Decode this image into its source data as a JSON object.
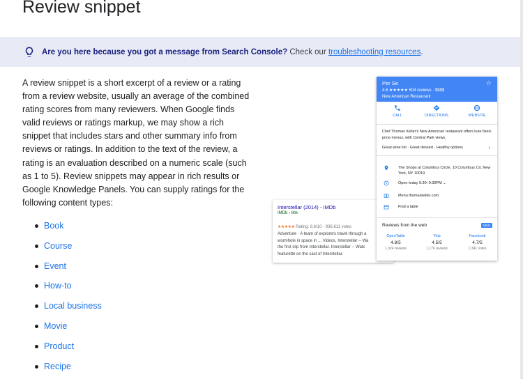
{
  "page": {
    "title": "Review snippet"
  },
  "notice": {
    "question": "Are you here because you got a message from Search Console?",
    "prefix": "Check our",
    "link": "troubleshooting resources",
    "suffix": "."
  },
  "body": {
    "paragraph": "A review snippet is a short excerpt of a review or a rating from a review website, usually an average of the combined rating scores from many reviewers. When Google finds valid reviews or ratings markup, we may show a rich snippet that includes stars and other summary info from reviews or ratings. In addition to the text of the review, a rating is an evaluation described on a numeric scale (such as 1 to 5). Review snippets may appear in rich results or Google Knowledge Panels. You can supply ratings for the following content types:",
    "content_types": [
      "Book",
      "Course",
      "Event",
      "How-to",
      "Local business",
      "Movie",
      "Product",
      "Recipe"
    ]
  },
  "serp": {
    "title": "Interstellar (2014) - IMDb",
    "url": "IMDb › title",
    "stars": "★★★★★",
    "rating": "Rating: 8.6/10 - 936,611 votes",
    "snippet": [
      "Adventure · A team of explorers travel through a",
      "wormhole in space in ... Videos. Interstellar -- Wa",
      "the first clip from Interstellar. Interstellar -- Watc",
      "featurette on the cast of Interstellar."
    ]
  },
  "kp": {
    "name": "Per Se",
    "rating_line": "4.6 ★★★★★ 504 reviews · $$$$",
    "category": "New American Restaurant",
    "actions": {
      "call": "CALL",
      "directions": "DIRECTIONS",
      "website": "WEBSITE"
    },
    "description": "Chef Thomas Keller's New American restaurant offers luxe fixed-price menus, with Central Park views.",
    "highlights": "Great wine list · Great dessert · Healthy options",
    "address": "The Shops at Columbus Circle, 10 Columbus Cir, New York, NY 10019",
    "hours": "Open today 5:30–9:30PM ⌄",
    "menu": "Menu thomaskeller.com",
    "table": "Find a table",
    "reviews_title": "Reviews from the web",
    "new_badge": "NEW",
    "sources": [
      {
        "name": "OpenTable",
        "score": "4.8/5",
        "count": "1,324 reviews"
      },
      {
        "name": "Yelp",
        "score": "4.5/5",
        "count": "1,176 reviews"
      },
      {
        "name": "Facebook",
        "score": "4.7/5",
        "count": "1,341 votes"
      }
    ]
  },
  "colors": {
    "link": "#1a73e8",
    "notice_bg": "#e8eaf6",
    "kp_header": "#4285f4",
    "star": "#e7711b"
  }
}
